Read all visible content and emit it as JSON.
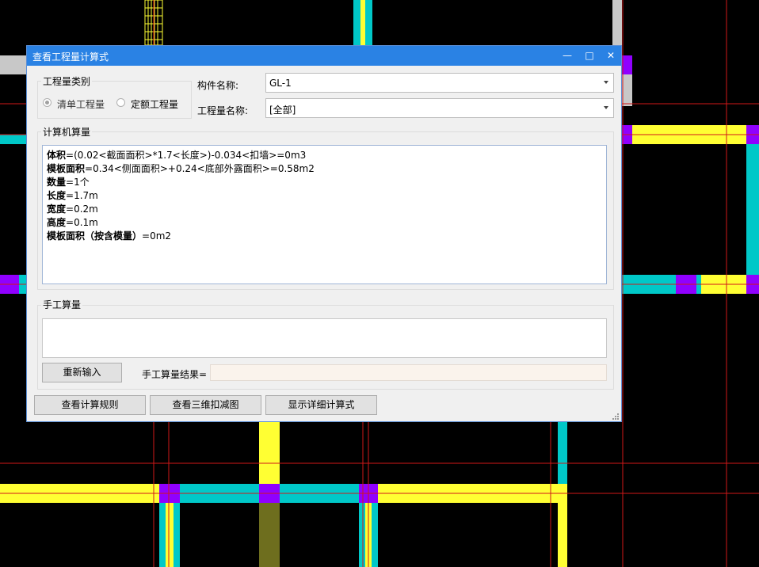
{
  "dialog": {
    "title": "查看工程量计算式",
    "controls": {
      "minimize": "—",
      "maximize": "□",
      "close": "✕"
    },
    "quantity_type": {
      "group_label": "工程量类别",
      "options": [
        "清单工程量",
        "定额工程量"
      ],
      "selected": "清单工程量"
    },
    "component_name": {
      "label": "构件名称:",
      "value": "GL-1"
    },
    "quantity_name": {
      "label": "工程量名称:",
      "value": "[全部]"
    },
    "computer_calc": {
      "group_label": "计算机算量",
      "lines": [
        {
          "key": "体积",
          "rest": "=(0.02<截面面积>*1.7<长度>)-0.034<扣墙>=0m3"
        },
        {
          "key": "模板面积",
          "rest": "=0.34<侧面面积>+0.24<底部外露面积>=0.58m2"
        },
        {
          "key": "数量",
          "rest": "=1个"
        },
        {
          "key": "长度",
          "rest": "=1.7m"
        },
        {
          "key": "宽度",
          "rest": "=0.2m"
        },
        {
          "key": "高度",
          "rest": "=0.1m"
        },
        {
          "key": "模板面积（按含模量）",
          "rest": "=0m2"
        }
      ]
    },
    "manual_calc": {
      "group_label": "手工算量",
      "reenter_button": "重新输入",
      "result_label": "手工算量结果=",
      "result_value": ""
    },
    "buttons": {
      "view_rules": "查看计算规则",
      "view_3d": "查看三维扣减图",
      "show_detail": "显示详细计算式"
    }
  },
  "colors": {
    "title_bar": "#2a82e4",
    "cad_background": "#000000",
    "cad_yellow": "#ffff33",
    "cad_cyan": "#00c8c8",
    "cad_purple": "#9000ff",
    "cad_red": "#d01818"
  }
}
